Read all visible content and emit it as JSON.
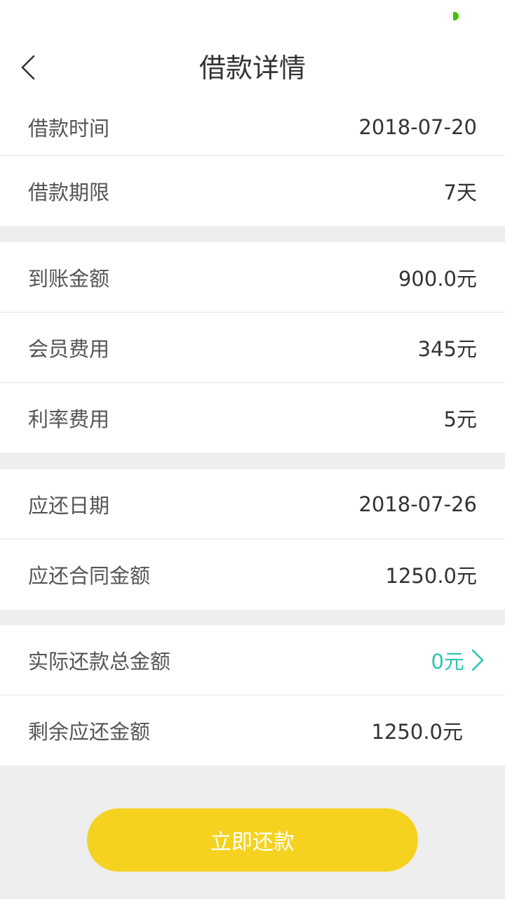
{
  "header": {
    "title": "借款详情",
    "back_icon": "back-arrow-icon"
  },
  "status_bar": {
    "indicator_color": "#42c300"
  },
  "groups": [
    {
      "rows": [
        {
          "label": "借款时间",
          "value": "2018-07-20"
        },
        {
          "label": "借款期限",
          "value": "7天"
        }
      ]
    },
    {
      "rows": [
        {
          "label": "到账金额",
          "value": "900.0元"
        },
        {
          "label": "会员费用",
          "value": "345元"
        },
        {
          "label": "利率费用",
          "value": "5元"
        }
      ]
    },
    {
      "rows": [
        {
          "label": "应还日期",
          "value": "2018-07-26"
        },
        {
          "label": "应还合同金额",
          "value": "1250.0元"
        }
      ]
    },
    {
      "rows": [
        {
          "label": "实际还款总金额",
          "value": "0元",
          "link_color": "#2ec4b6",
          "icon": "chevron-right-icon"
        },
        {
          "label": "剩余应还金额",
          "value": "1250.0元"
        }
      ]
    }
  ],
  "action": {
    "pay_label": "立即还款",
    "button_color": "#f5d21f"
  }
}
